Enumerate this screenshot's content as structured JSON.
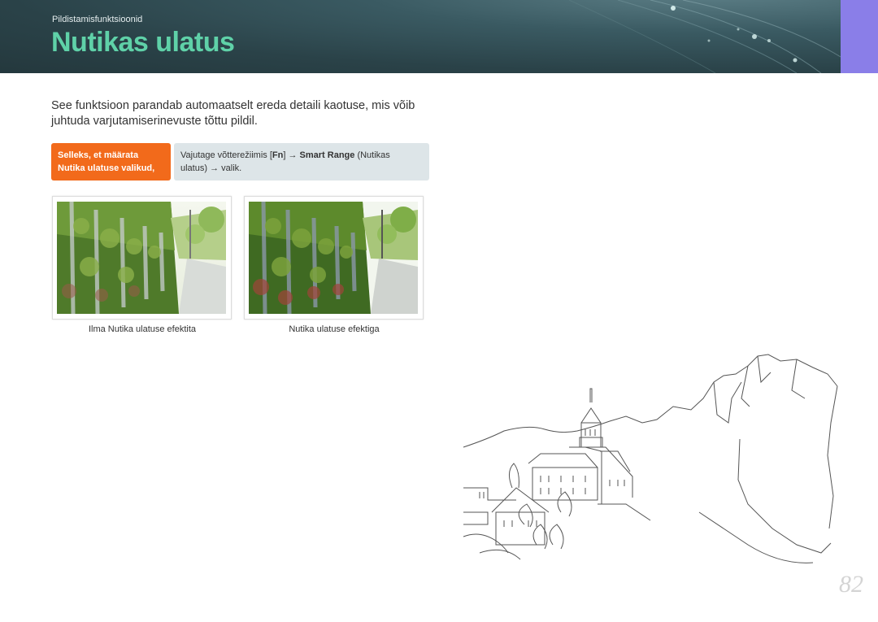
{
  "header": {
    "section_label": "Pildistamisfunktsioonid",
    "title": "Nutikas ulatus"
  },
  "intro": {
    "text": "See funktsioon parandab automaatselt ereda detaili kaotuse, mis võib juhtuda varjutamiserinevuste tõttu pildil."
  },
  "howto": {
    "label_line1": "Selleks, et määrata",
    "label_line2": "Nutika ulatuse valikud,",
    "text_before": "Vajutage võtterežiimis [",
    "key": "Fn",
    "text_after": "] → ",
    "option_name": "Smart Range",
    "text_end_line1": " (Nutikas",
    "text_line2": "ulatus) → valik."
  },
  "photos": [
    {
      "caption": "Ilma Nutika ulatuse efektita"
    },
    {
      "caption": "Nutika ulatuse efektiga"
    }
  ],
  "page_number": "82",
  "colors": {
    "header_bg": "#2a4248",
    "title": "#5fd1a8",
    "corner_tab": "#8a7ee8",
    "howto_label_bg": "#f26a1b",
    "howto_text_bg": "#dde5e8"
  }
}
